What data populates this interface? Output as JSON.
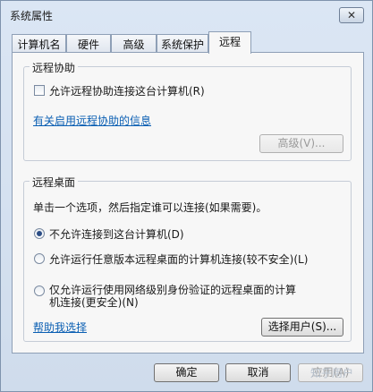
{
  "window": {
    "title": "系统属性",
    "close_glyph": "✕"
  },
  "tabs": [
    {
      "label": "计算机名"
    },
    {
      "label": "硬件"
    },
    {
      "label": "高级"
    },
    {
      "label": "系统保护"
    },
    {
      "label": "远程"
    }
  ],
  "remote_assistance": {
    "title": "远程协助",
    "allow_checkbox_label": "允许远程协助连接这台计算机(R)",
    "allow_checked": false,
    "info_link": "有关启用远程协助的信息",
    "advanced_button": "高级(V)..."
  },
  "remote_desktop": {
    "title": "远程桌面",
    "instruction": "单击一个选项，然后指定谁可以连接(如果需要)。",
    "options": [
      {
        "label": "不允许连接到这台计算机(D)",
        "checked": true
      },
      {
        "label": "允许运行任意版本远程桌面的计算机连接(较不安全)(L)",
        "checked": false
      },
      {
        "label": "仅允许运行使用网络级别身份验证的远程桌面的计算",
        "label_line2": "机连接(更安全)(N)",
        "checked": false
      }
    ],
    "help_link": "帮助我选择",
    "select_users_button": "选择用户(S)..."
  },
  "footer": {
    "ok": "确定",
    "cancel": "取消",
    "apply": "应用(A)"
  },
  "watermark": "知乎用户"
}
